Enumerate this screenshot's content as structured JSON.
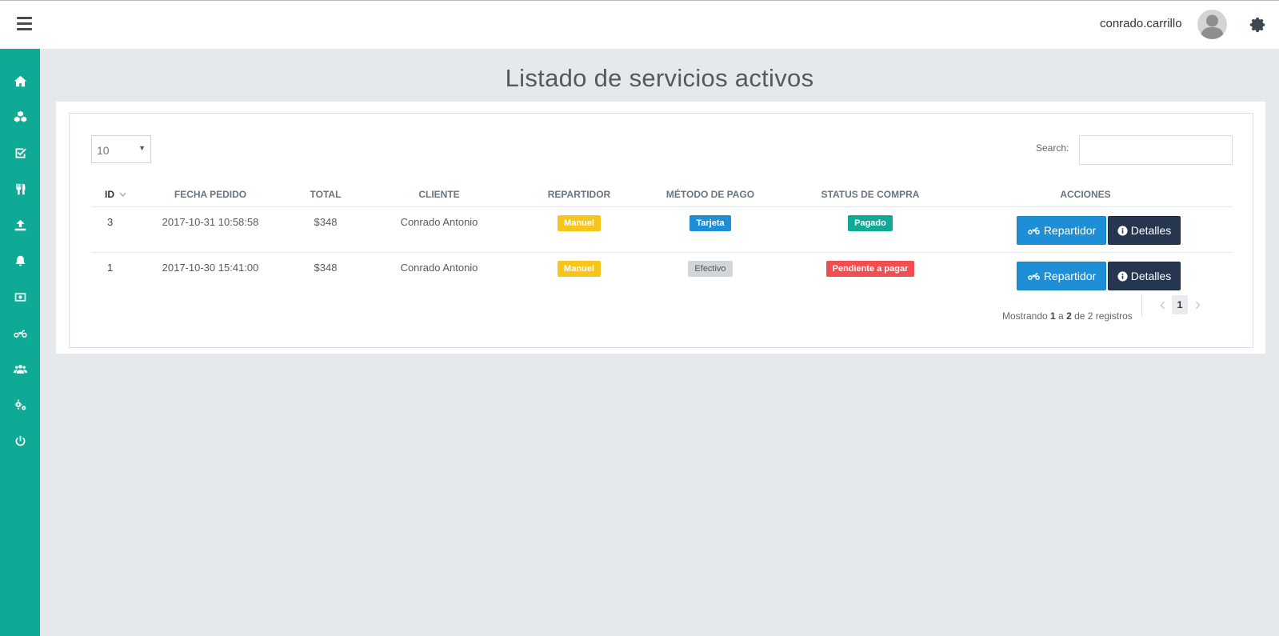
{
  "header": {
    "username": "conrado.carrillo",
    "menu_icon": "hamburger-menu-icon",
    "avatar_icon": "user-avatar-icon",
    "settings_icon": "gear-icon"
  },
  "sidebar": {
    "items": [
      {
        "name": "home",
        "icon": "home-icon"
      },
      {
        "name": "products",
        "icon": "cubes-icon"
      },
      {
        "name": "orders",
        "icon": "check-square-icon"
      },
      {
        "name": "restaurants",
        "icon": "cutlery-icon"
      },
      {
        "name": "upload",
        "icon": "upload-icon"
      },
      {
        "name": "notifications",
        "icon": "bell-icon"
      },
      {
        "name": "payments",
        "icon": "money-icon"
      },
      {
        "name": "deliveries",
        "icon": "motorcycle-icon"
      },
      {
        "name": "users",
        "icon": "users-icon"
      },
      {
        "name": "settings",
        "icon": "cogs-icon"
      },
      {
        "name": "logout",
        "icon": "power-icon"
      }
    ]
  },
  "page": {
    "title": "Listado de servicios activos"
  },
  "table_controls": {
    "page_length": "10",
    "search_label": "Search:",
    "search_value": ""
  },
  "table": {
    "headers": {
      "id": "ID",
      "fecha": "FECHA PEDIDO",
      "total": "TOTAL",
      "cliente": "CLIENTE",
      "repartidor": "REPARTIDOR",
      "metodo": "MÉTODO DE PAGO",
      "status": "STATUS DE COMPRA",
      "acciones": "ACCIONES"
    },
    "rows": [
      {
        "id": "3",
        "fecha": "2017-10-31 10:58:58",
        "total": "$348",
        "cliente": "Conrado Antonio",
        "repartidor": "Manuel",
        "metodo": "Tarjeta",
        "status": "Pagado",
        "btn_repartidor": "Repartidor",
        "btn_detalles": "Detalles"
      },
      {
        "id": "1",
        "fecha": "2017-10-30 15:41:00",
        "total": "$348",
        "cliente": "Conrado Antonio",
        "repartidor": "Manuel",
        "metodo": "Efectivo",
        "status": "Pendiente a pagar",
        "btn_repartidor": "Repartidor",
        "btn_detalles": "Detalles"
      }
    ]
  },
  "footer": {
    "info_prefix": "Mostrando ",
    "info_from": "1",
    "info_mid": " a ",
    "info_to": "2",
    "info_suffix": " de 2 registros",
    "current_page": "1"
  },
  "colors": {
    "sidebar": "#0eaa96",
    "background": "#e5e9ec",
    "label_yellow": "#f8c51c",
    "label_blue": "#1e8fd7",
    "label_green": "#0eaa96",
    "label_red": "#f04e51",
    "button_dark": "#263650"
  }
}
